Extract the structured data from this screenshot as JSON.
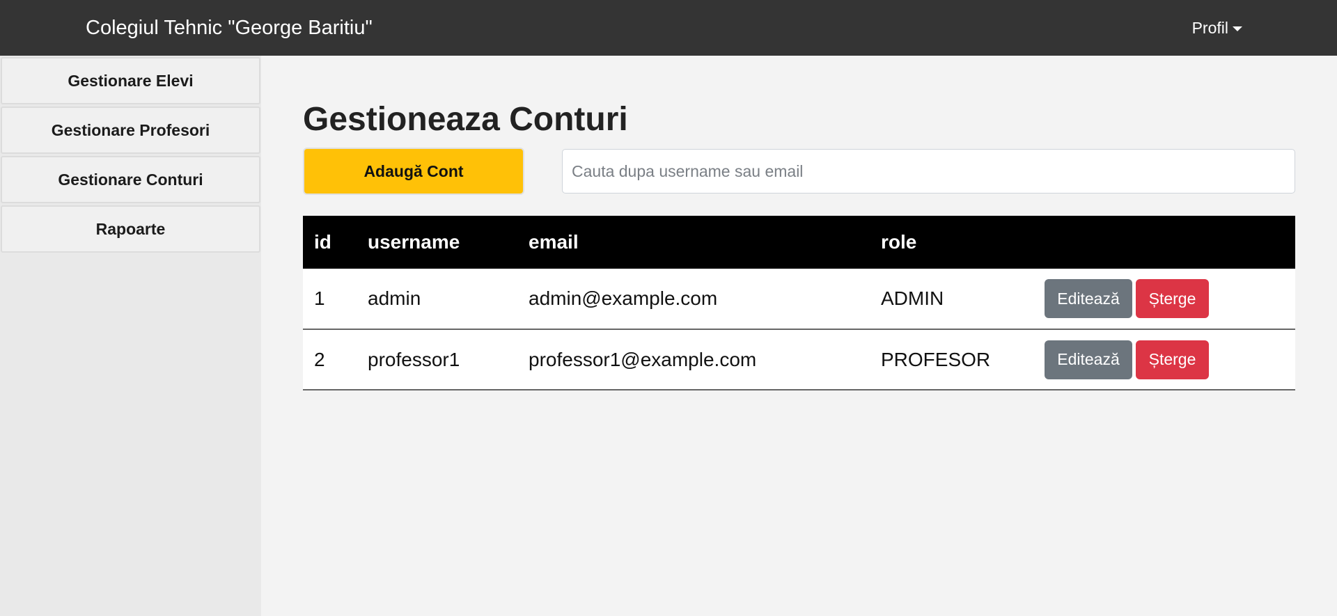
{
  "navbar": {
    "brand": "Colegiul Tehnic \"George Baritiu\"",
    "profile_label": "Profil"
  },
  "sidebar": {
    "items": [
      {
        "label": "Gestionare Elevi"
      },
      {
        "label": "Gestionare Profesori"
      },
      {
        "label": "Gestionare Conturi"
      },
      {
        "label": "Rapoarte"
      }
    ]
  },
  "main": {
    "title": "Gestioneaza Conturi",
    "add_button": "Adaugă Cont",
    "search_placeholder": "Cauta dupa username sau email"
  },
  "table": {
    "headers": {
      "id": "id",
      "username": "username",
      "email": "email",
      "role": "role",
      "actions": ""
    },
    "rows": [
      {
        "id": "1",
        "username": "admin",
        "email": "admin@example.com",
        "role": "ADMIN",
        "edit": "Editează",
        "delete": "Șterge"
      },
      {
        "id": "2",
        "username": "professor1",
        "email": "professor1@example.com",
        "role": "PROFESOR",
        "edit": "Editează",
        "delete": "Șterge"
      }
    ]
  },
  "colors": {
    "navbar_bg": "#343434",
    "add_button_bg": "#ffc107",
    "edit_button_bg": "#6c757d",
    "delete_button_bg": "#dc3545",
    "table_header_bg": "#000000"
  }
}
